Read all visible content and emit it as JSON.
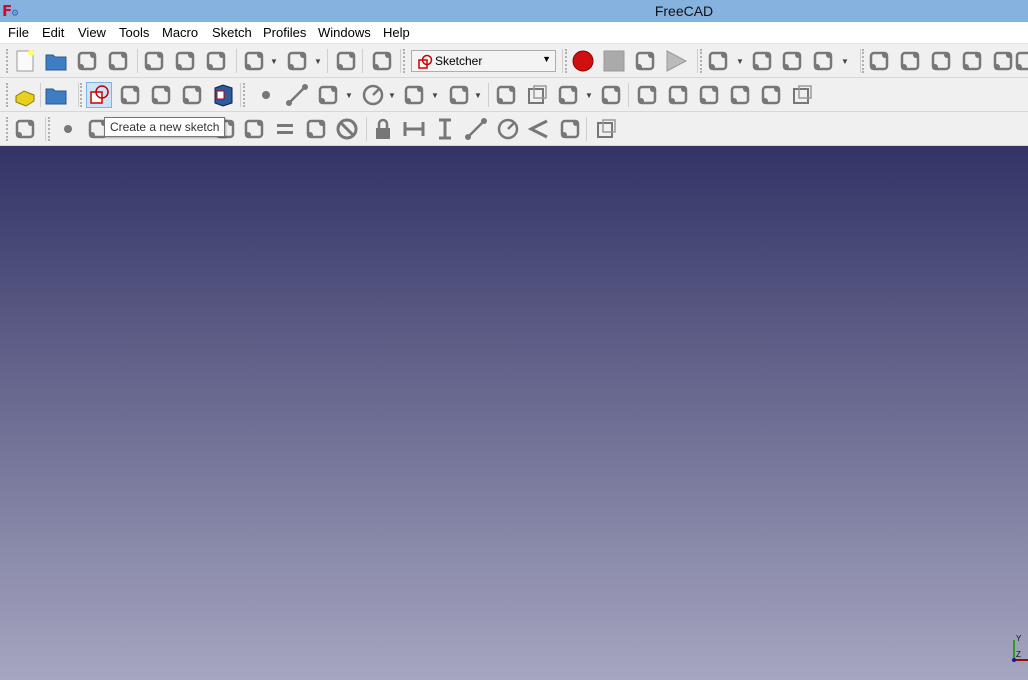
{
  "window": {
    "title": "FreeCAD",
    "logo": "F"
  },
  "menu": [
    "File",
    "Edit",
    "View",
    "Tools",
    "Macro",
    "Sketch",
    "Profiles",
    "Windows",
    "Help"
  ],
  "toolbar": {
    "workbench_selector": {
      "value": "Sketcher",
      "icon": "sketcher-icon"
    },
    "row1": [
      "new-document-icon",
      "open-icon",
      "save-icon",
      "save-as-icon",
      "cut-icon",
      "copy-icon",
      "paste-icon",
      "undo-icon",
      "redo-icon",
      "refresh-icon",
      "whats-this-icon",
      "macro-record-icon",
      "macro-stop-icon",
      "macro-edit-icon",
      "macro-play-icon",
      "sketch-view-icon",
      "close-shape-icon",
      "constraints-select-icon",
      "constraints-select-2-icon",
      "symmetric-hv-icon",
      "mirror-icon",
      "reflection-icon",
      "parallel-lines-icon",
      "ellipse-icon",
      "more-icon"
    ],
    "row2": [
      "part-icon",
      "group-icon",
      "new-sketch-icon",
      "map-sketch-icon",
      "reorient-icon",
      "validate-icon",
      "merge-icon",
      "point-icon",
      "line-icon",
      "arc-icon",
      "circle-icon",
      "conic-icon",
      "bspline-icon",
      "polyline-icon",
      "rectangle-icon",
      "polygon-icon",
      "slot-icon",
      "fillet-icon",
      "trim-icon",
      "extend-icon",
      "external-geometry-icon",
      "carbon-copy-icon",
      "construction-mode-icon"
    ],
    "row3": [
      "constraint-toggle-icon",
      "constraint-point-icon",
      "constraint-coincident-icon",
      "constraint-perpendicular-icon",
      "constraint-tangent-icon",
      "constraint-equal-icon",
      "constraint-symmetric-icon",
      "constraint-block-icon",
      "constraint-lock-icon",
      "constraint-horizontal-distance-icon",
      "constraint-vertical-distance-icon",
      "constraint-length-icon",
      "constraint-radius-icon",
      "constraint-angle-icon",
      "constraint-snell-icon",
      "internal-alignment-icon"
    ]
  },
  "tooltip": "Create a new sketch",
  "axis": {
    "y": "Y",
    "z": "Z"
  },
  "colors": {
    "titlebar": "#85b2de",
    "viewport_top": "#333366",
    "viewport_bottom": "#a6a6c0",
    "record": "#d01010"
  }
}
